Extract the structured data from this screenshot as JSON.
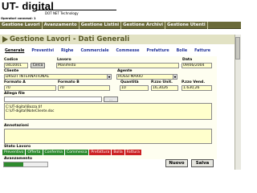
{
  "logo": {
    "name": "UT- digital",
    "tagline": "DOT NET Technology"
  },
  "operator": {
    "label": "Operatori connessi: 1"
  },
  "top_menu": [
    "Gestione Lavori",
    "Avanzamento",
    "Gestione Listini",
    "Gestione Archivi",
    "Gestione Utenti"
  ],
  "page_title": "Gestione Lavori - Dati Generali",
  "tabs": [
    "Generale",
    "Preventivi",
    "Righe",
    "Commerciale",
    "Commesse",
    "Prefatture",
    "Bolle",
    "Fatture"
  ],
  "form": {
    "codice": {
      "label": "Codice",
      "value": "04L0001"
    },
    "cerca_label": "Cerca",
    "lavoro": {
      "label": "Lavoro",
      "value": "Manifesto"
    },
    "data": {
      "label": "Data",
      "value": "09/06/2004"
    },
    "cliente": {
      "label": "Cliente",
      "value": "DRSUT INTERNATIONAL"
    },
    "agente": {
      "label": "Agente",
      "value": "ROSSI MARIO"
    },
    "formato_a": {
      "label": "Formato A",
      "value": "70"
    },
    "formato_b": {
      "label": "Formato B",
      "value": "70"
    },
    "quantita": {
      "label": "Quantità",
      "value": "10"
    },
    "pzzo_unit": {
      "label": "P.zzo Unit.",
      "value": "16,3026"
    },
    "pzzo_vend": {
      "label": "P.zzo Vend.",
      "value": "1.630,26"
    },
    "allega_file": {
      "label": "Allega file",
      "files": [
        "C:\\UT-digital\\Bozza.tif",
        "C:\\UT-digital\\NoteCliente.doc"
      ]
    },
    "annotazioni": {
      "label": "Annotazioni",
      "value": ""
    }
  },
  "stato_lavoro": {
    "label": "Stato Lavoro",
    "steps": [
      {
        "label": "Preventivo",
        "color": "#2e8b2e"
      },
      {
        "label": "Offerta",
        "color": "#2e8b2e"
      },
      {
        "label": "Conferma",
        "color": "#2e8b2e"
      },
      {
        "label": "Commessa",
        "color": "#2e8b2e"
      },
      {
        "label": "Prefattura",
        "color": "#cc2222"
      },
      {
        "label": "Bolla",
        "color": "#cc2222"
      },
      {
        "label": "Fattura",
        "color": "#cc2222"
      }
    ]
  },
  "avanzamento": {
    "label": "Avanzamento",
    "progress": 0.45
  },
  "buttons": {
    "nuovo": "Nuovo",
    "salva": "Salva"
  },
  "colors": {
    "menu_bg": "#6b6b3a",
    "title_color": "#5a5a2a",
    "done": "#2e8b2e",
    "pending": "#cc2222"
  }
}
